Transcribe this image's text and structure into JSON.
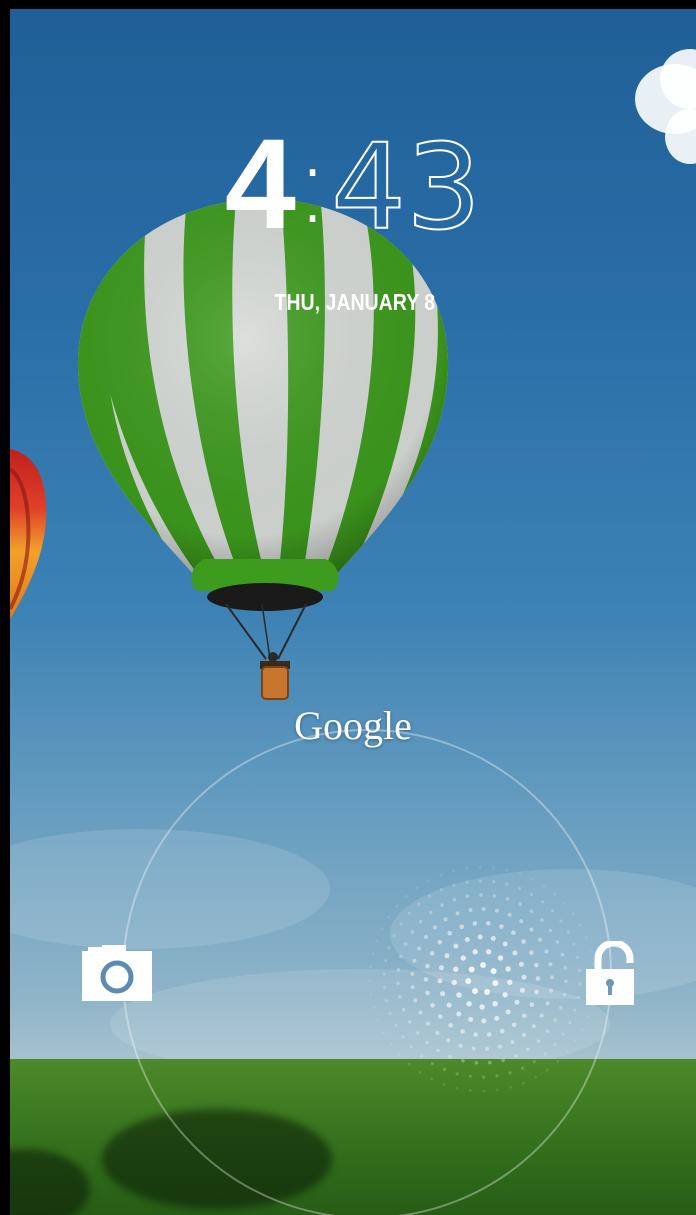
{
  "lockscreen": {
    "clock": {
      "hours": "4",
      "separator": ":",
      "minutes": "43"
    },
    "date": "THU, JANUARY 8",
    "search_label": "Google",
    "icons": {
      "camera": "camera-icon",
      "unlock": "unlock-icon"
    }
  },
  "colors": {
    "sky_top": "#1f5f96",
    "sky_bottom": "#a9c4cf",
    "grass": "#3f7c22",
    "text": "#ffffff",
    "balloon_green": "#3c9a1c",
    "balloon_white": "#d8dcd8"
  }
}
